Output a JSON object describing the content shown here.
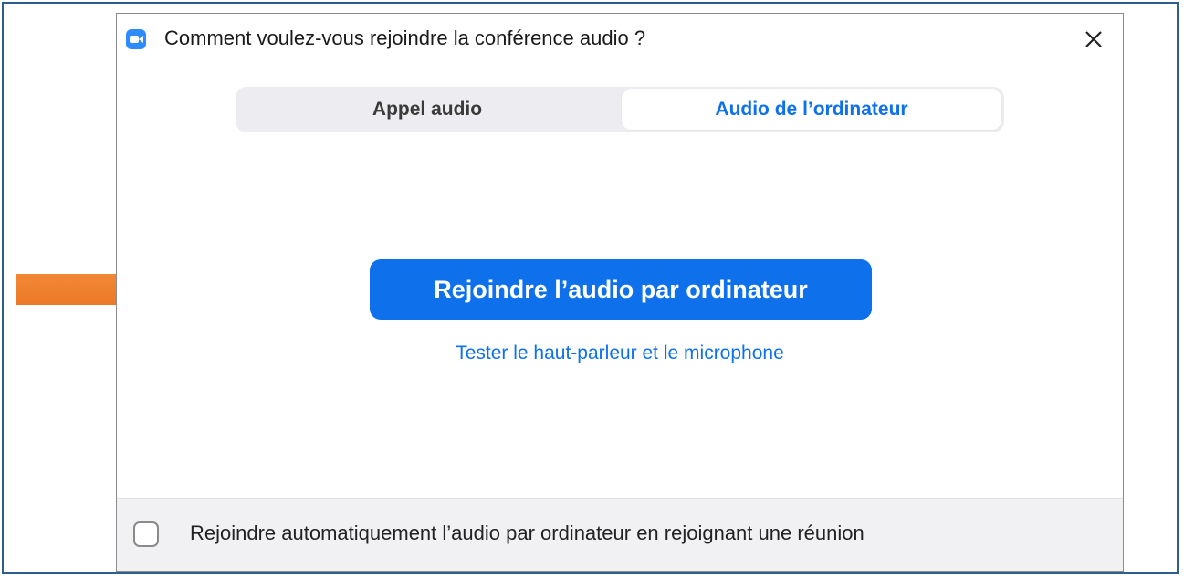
{
  "dialog": {
    "title": "Comment voulez-vous rejoindre la conférence audio ?",
    "app_icon": "zoom-video-icon",
    "close_icon": "close-icon"
  },
  "tabs": [
    {
      "label": "Appel audio",
      "selected": false
    },
    {
      "label": "Audio de l’ordinateur",
      "selected": true
    }
  ],
  "main": {
    "join_button_label": "Rejoindre l’audio par ordinateur",
    "test_link_label": "Tester le haut-parleur et le microphone"
  },
  "footer": {
    "auto_join_label": "Rejoindre automatiquement l’audio par ordinateur en rejoignant une réunion",
    "auto_join_checked": false
  },
  "annotation": {
    "arrow_icon": "arrow-right-icon",
    "arrow_color": "#f07c28"
  },
  "colors": {
    "accent": "#0e71eb",
    "frame": "#2f5d8c"
  }
}
